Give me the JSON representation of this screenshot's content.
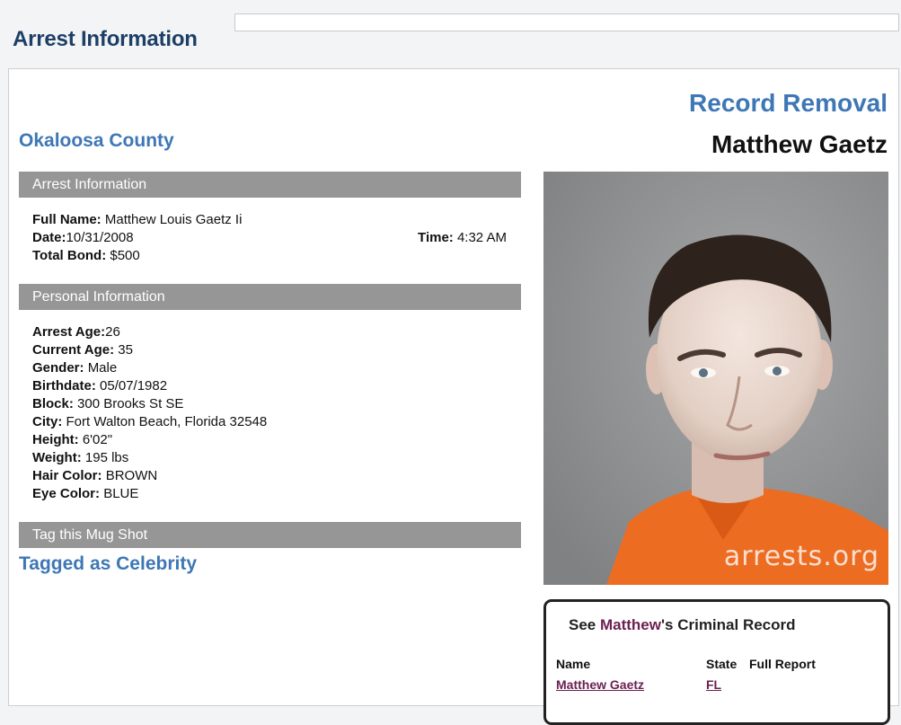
{
  "header": {
    "page_title": "Arrest Information"
  },
  "record": {
    "removal_link": "Record Removal",
    "person_name": "Matthew Gaetz",
    "county": "Okaloosa County"
  },
  "sections": {
    "arrest_info": "Arrest Information",
    "personal_info": "Personal Information",
    "tag_mugshot": "Tag this Mug Shot"
  },
  "arrest": {
    "full_name_label": "Full Name:",
    "full_name": "Matthew Louis Gaetz Ii",
    "date_label": "Date:",
    "date": "10/31/2008",
    "time_label": "Time:",
    "time": "4:32 AM",
    "bond_label": "Total Bond:",
    "bond": "$500"
  },
  "personal": [
    {
      "label": "Arrest Age:",
      "value": "26"
    },
    {
      "label": "Current Age:",
      "value": "35"
    },
    {
      "label": "Gender:",
      "value": "Male"
    },
    {
      "label": "Birthdate:",
      "value": "05/07/1982"
    },
    {
      "label": "Block:",
      "value": "300 Brooks St SE"
    },
    {
      "label": "City:",
      "value": "Fort Walton Beach, Florida 32548"
    },
    {
      "label": "Height:",
      "value": "6'02\""
    },
    {
      "label": "Weight:",
      "value": "195 lbs"
    },
    {
      "label": "Hair Color:",
      "value": "BROWN"
    },
    {
      "label": "Eye Color:",
      "value": "BLUE"
    }
  ],
  "tagged": "Tagged as Celebrity",
  "mugshot": {
    "watermark": "arrests.org"
  },
  "criminal_record": {
    "title_prefix": "See ",
    "title_name": "Matthew",
    "title_suffix": "'s Criminal Record",
    "headers": [
      "Name",
      "State",
      "Full Report"
    ],
    "row": {
      "name": "Matthew Gaetz",
      "state": "FL"
    }
  },
  "colors": {
    "title_navy": "#1d3f66",
    "accent_blue": "#3e77b5",
    "section_gray": "#969696",
    "link_plum": "#6b2152"
  }
}
